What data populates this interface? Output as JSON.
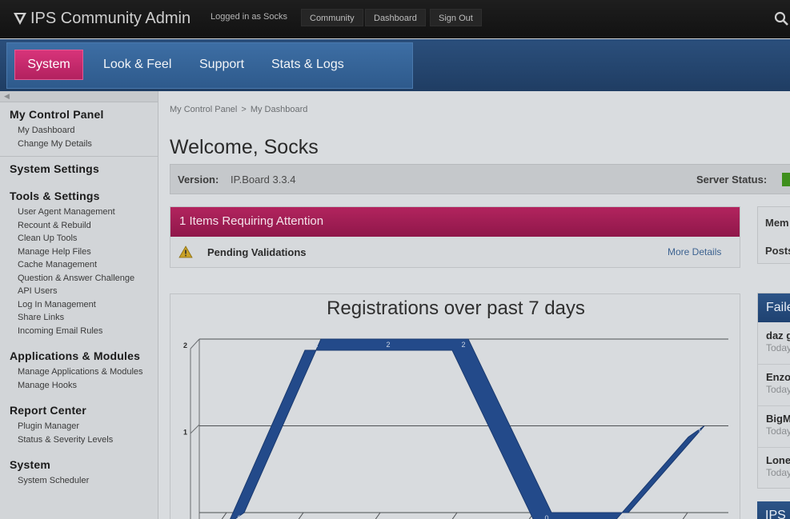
{
  "topbar": {
    "app_title": "IPS Community Admin",
    "logged_in": "Logged in as Socks",
    "buttons": [
      "Community",
      "Dashboard",
      "Sign Out"
    ]
  },
  "nav": {
    "active": "System",
    "items": [
      "Look & Feel",
      "Support",
      "Stats & Logs"
    ]
  },
  "sidebar": {
    "groups": [
      {
        "title": "My Control Panel",
        "links": [
          "My Dashboard",
          "Change My Details"
        ]
      },
      {
        "title": "System Settings",
        "links": []
      },
      {
        "title": "Tools & Settings",
        "links": [
          "User Agent Management",
          "Recount & Rebuild",
          "Clean Up Tools",
          "Manage Help Files",
          "Cache Management",
          "Question & Answer Challenge",
          "API Users",
          "Log In Management",
          "Share Links",
          "Incoming Email Rules"
        ]
      },
      {
        "title": "Applications & Modules",
        "links": [
          "Manage Applications & Modules",
          "Manage Hooks"
        ]
      },
      {
        "title": "Report Center",
        "links": [
          "Plugin Manager",
          "Status & Severity Levels"
        ]
      },
      {
        "title": "System",
        "links": [
          "System Scheduler"
        ]
      }
    ]
  },
  "main": {
    "breadcrumb": [
      "My Control Panel",
      "My Dashboard"
    ],
    "breadcrumb_sep": ">",
    "welcome": "Welcome, Socks",
    "version_label": "Version:",
    "version_value": "IP.Board 3.3.4",
    "server_status_label": "Server Status:",
    "attention": {
      "title": "1 Items Requiring Attention",
      "item": "Pending Validations",
      "link": "More Details"
    }
  },
  "right": {
    "stats": [
      "Mem",
      "Posts"
    ],
    "failed_title": "Faile",
    "failed": [
      {
        "name": "daz g",
        "time": "Today"
      },
      {
        "name": "Enzo",
        "time": "Today"
      },
      {
        "name": "BigM",
        "time": "Today"
      },
      {
        "name": "Lone",
        "time": "Today"
      }
    ],
    "bottom_box": "IPS"
  },
  "colors": {
    "accent_pink": "#b2215f",
    "nav_blue": "#2e5a8c",
    "status_green": "#3f8f1d",
    "chart_series": "#234a8a"
  },
  "chart_data": {
    "type": "area",
    "title": "Registrations over past 7 days",
    "y_ticks": [
      "1",
      "2"
    ],
    "ylim": [
      0,
      2
    ],
    "points": [
      0,
      2,
      2,
      2,
      0,
      0,
      1
    ],
    "point_labels": [
      "0",
      "2",
      "2",
      "2",
      "0",
      "0",
      "1"
    ],
    "grid": true
  }
}
